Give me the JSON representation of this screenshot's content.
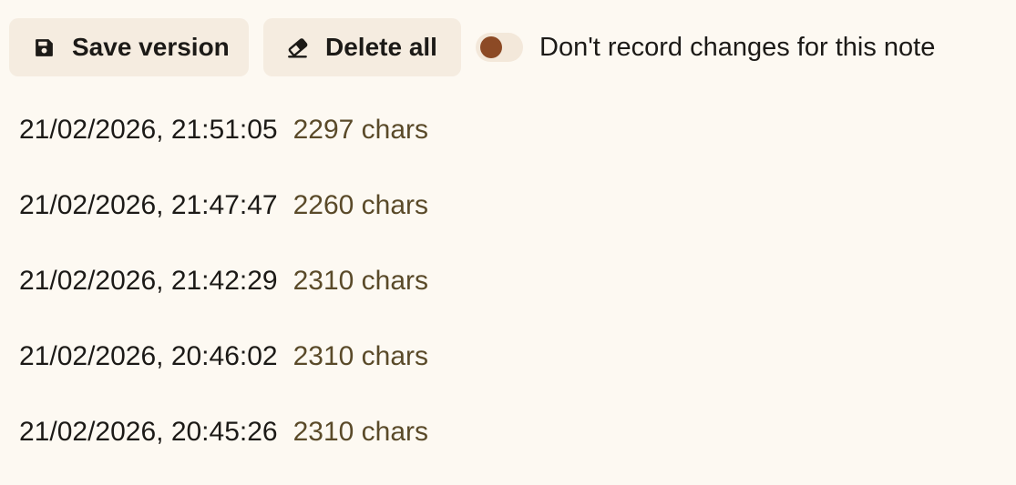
{
  "toolbar": {
    "save_label": "Save version",
    "save_icon": "floppy-disk-icon",
    "delete_label": "Delete all",
    "delete_icon": "eraser-icon",
    "toggle_label": "Don't record changes for this note",
    "toggle_on": false,
    "accent_color": "#8c4a25"
  },
  "history": [
    {
      "timestamp": "21/02/2026, 21:51:05",
      "chars": "2297 chars"
    },
    {
      "timestamp": "21/02/2026, 21:47:47",
      "chars": "2260 chars"
    },
    {
      "timestamp": "21/02/2026, 21:42:29",
      "chars": "2310 chars"
    },
    {
      "timestamp": "21/02/2026, 20:46:02",
      "chars": "2310 chars"
    },
    {
      "timestamp": "21/02/2026, 20:45:26",
      "chars": "2310 chars"
    }
  ]
}
